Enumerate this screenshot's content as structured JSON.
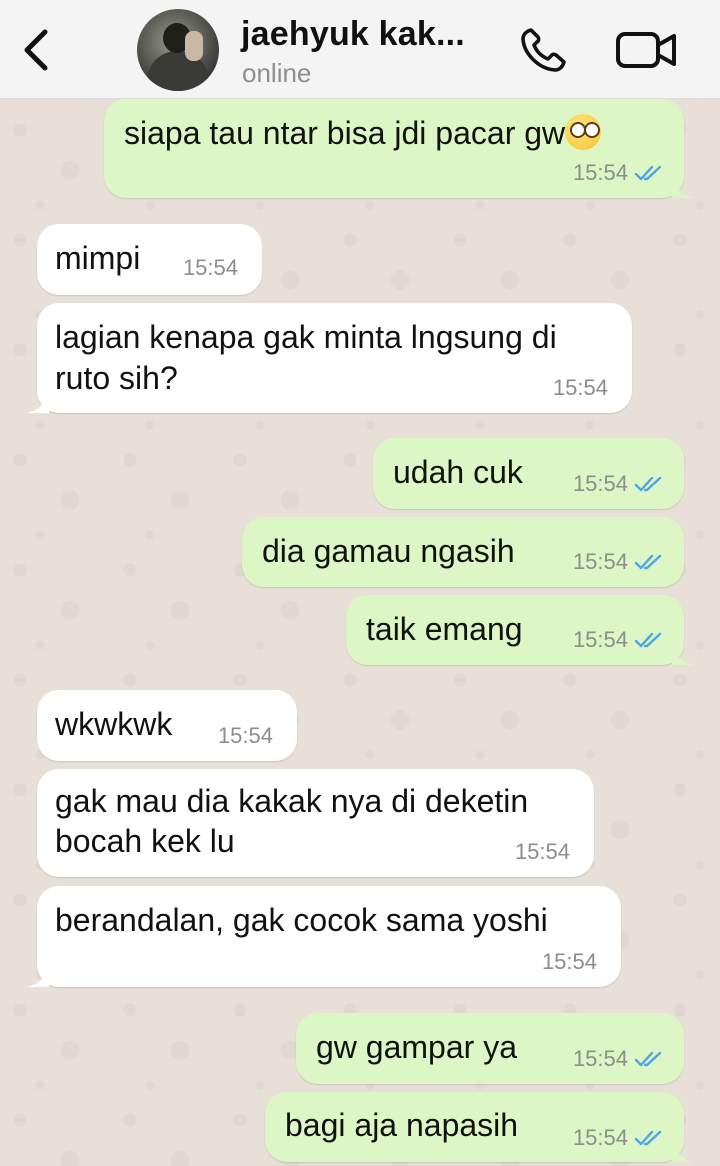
{
  "header": {
    "contact_name": "jaehyuk kak...",
    "status": "online",
    "back_icon": "chevron-left-icon",
    "call_icon": "phone-icon",
    "video_icon": "video-camera-icon"
  },
  "colors": {
    "outgoing_bubble": "#dcf7c5",
    "incoming_bubble": "#ffffff",
    "read_ticks": "#4fa3e6"
  },
  "messages": [
    {
      "direction": "out",
      "text": "siapa tau ntar bisa jdi pacar gw",
      "emoji": "face-with-rolling-eyes",
      "time": "15:54",
      "status": "read"
    },
    {
      "direction": "in",
      "text": "mimpi",
      "time": "15:54"
    },
    {
      "direction": "in",
      "lines": [
        "lagian kenapa gak minta lngsung di",
        "ruto sih?"
      ],
      "time": "15:54"
    },
    {
      "direction": "out",
      "text": "udah cuk",
      "time": "15:54",
      "status": "read"
    },
    {
      "direction": "out",
      "text": "dia gamau ngasih",
      "time": "15:54",
      "status": "read"
    },
    {
      "direction": "out",
      "text": "taik emang",
      "time": "15:54",
      "status": "read"
    },
    {
      "direction": "in",
      "text": "wkwkwk",
      "time": "15:54"
    },
    {
      "direction": "in",
      "lines": [
        "gak mau dia kakak nya di deketin",
        "bocah kek lu"
      ],
      "time": "15:54"
    },
    {
      "direction": "in",
      "text": "berandalan, gak cocok sama yoshi",
      "time": "15:54"
    },
    {
      "direction": "out",
      "text": "gw gampar ya",
      "time": "15:54",
      "status": "read"
    },
    {
      "direction": "out",
      "text": "bagi aja napasih",
      "time": "15:54",
      "status": "read"
    }
  ]
}
